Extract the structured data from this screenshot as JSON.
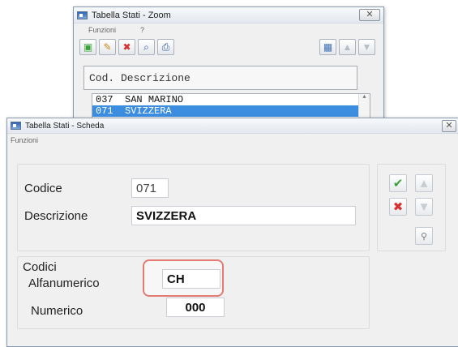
{
  "zoom_window": {
    "title": "Tabella Stati - Zoom",
    "close_glyph": "✕",
    "menu": [
      "Funzioni",
      "?"
    ],
    "toolbar_icons": [
      "new-icon",
      "edit-icon",
      "delete-icon",
      "search-icon",
      "print-icon"
    ],
    "header": "Cod. Descrizione",
    "rows": [
      {
        "code": "037",
        "desc": "SAN MARINO"
      },
      {
        "code": "071",
        "desc": "SVIZZERA"
      }
    ]
  },
  "scheda_window": {
    "title": "Tabella Stati - Scheda",
    "close_glyph": "✕",
    "menu": [
      "Funzioni"
    ],
    "codice_label": "Codice",
    "codice_value": "071",
    "descrizione_label": "Descrizione",
    "descrizione_value": "SVIZZERA",
    "codici_label": "Codici",
    "alfanumerico_label": "Alfanumerico",
    "alfanumerico_value": "CH",
    "numerico_label": "Numerico",
    "numerico_value": "000"
  },
  "icons": {
    "confirm": "✔",
    "cancel": "✖",
    "up": "▲",
    "down": "▼",
    "binoculars": "🔭"
  },
  "colors": {
    "selection": "#3b8de0",
    "highlight_border": "#e47b73",
    "confirm": "#3aa23a",
    "cancel": "#d93030"
  }
}
